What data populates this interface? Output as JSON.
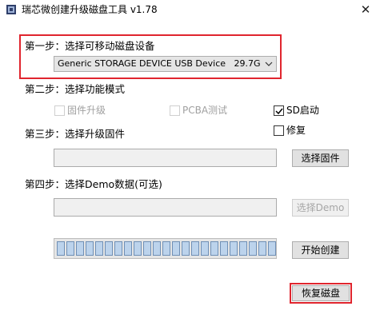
{
  "window": {
    "title": "瑞芯微创建升级磁盘工具 v1.78",
    "close_glyph": "✕",
    "icon": "app-chip-icon"
  },
  "step1": {
    "label": "第一步：选择可移动磁盘设备",
    "device": "Generic STORAGE DEVICE USB Device",
    "size": "29.7G"
  },
  "step2": {
    "label": "第二步：选择功能模式",
    "options": [
      {
        "label": "固件升级",
        "checked": false,
        "enabled": false
      },
      {
        "label": "PCBA测试",
        "checked": false,
        "enabled": false
      },
      {
        "label": "SD启动",
        "checked": true,
        "enabled": true
      },
      {
        "label": "修复",
        "checked": false,
        "enabled": true
      }
    ]
  },
  "step3": {
    "label": "第三步：选择升级固件",
    "firmware_path": "",
    "button": "选择固件"
  },
  "step4": {
    "label": "第四步：选择Demo数据(可选)",
    "demo_path": "",
    "button": "选择Demo"
  },
  "progress": {
    "fraction": 1.0
  },
  "actions": {
    "create": "开始创建",
    "restore": "恢复磁盘"
  },
  "colors": {
    "highlight": "#e0252e",
    "progress_fill": "#bcd3ec"
  }
}
